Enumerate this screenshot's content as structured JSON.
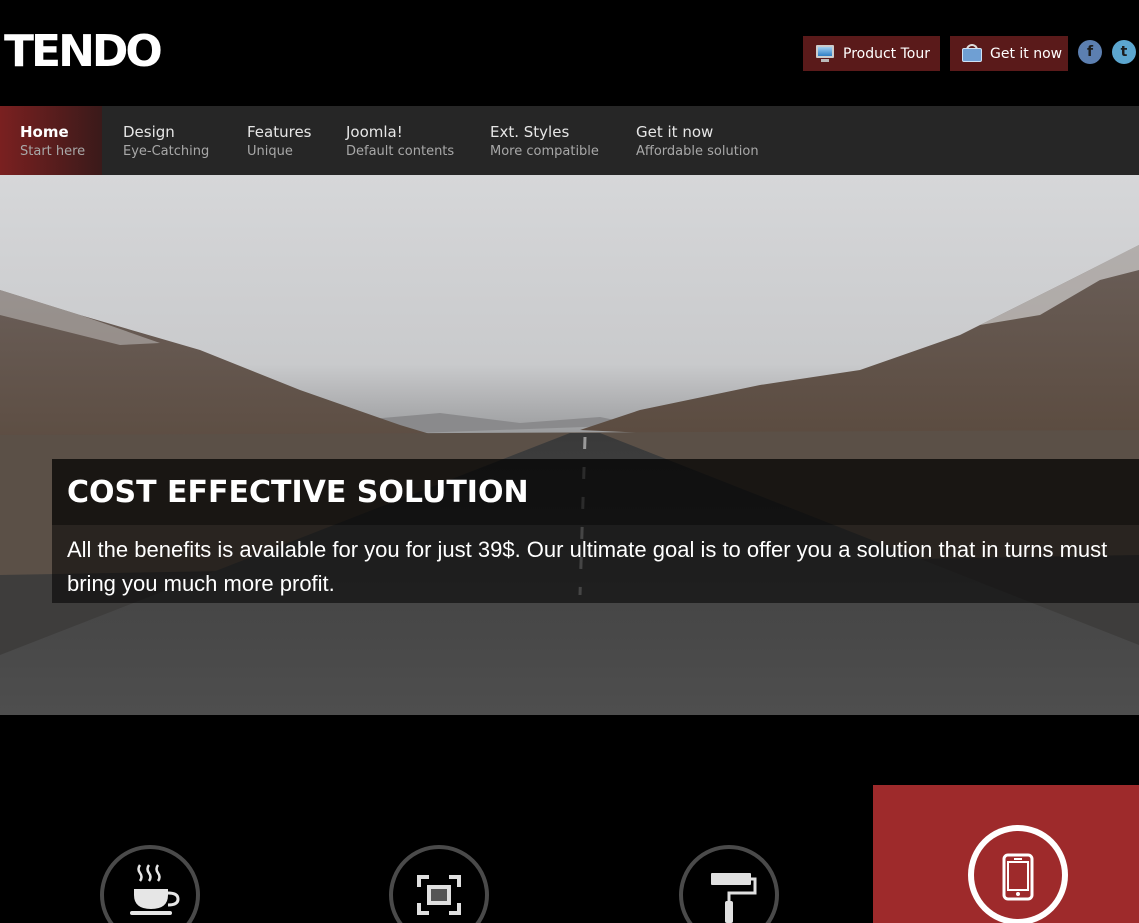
{
  "header": {
    "logo_text": "TENDO",
    "buttons": [
      {
        "label": "Product Tour",
        "icon": "monitor-icon"
      },
      {
        "label": "Get it now",
        "icon": "basket-icon"
      }
    ],
    "social": [
      {
        "icon": "facebook-icon",
        "glyph": "f"
      },
      {
        "icon": "twitter-icon",
        "glyph": "t"
      }
    ]
  },
  "nav": {
    "items": [
      {
        "title": "Home",
        "sub": "Start here",
        "active": true
      },
      {
        "title": "Design",
        "sub": "Eye-Catching"
      },
      {
        "title": "Features",
        "sub": "Unique"
      },
      {
        "title": "Joomla!",
        "sub": "Default contents"
      },
      {
        "title": "Ext. Styles",
        "sub": "More compatible"
      },
      {
        "title": "Get it now",
        "sub": "Affordable solution"
      }
    ]
  },
  "hero": {
    "title": "COST EFFECTIVE SOLUTION",
    "text": "All the benefits is available for you for just 39$. Our ultimate goal is to offer you a solution that in turns must bring you much more profit."
  },
  "features": {
    "icons": [
      "coffee-cup-icon",
      "frame-icon",
      "paint-roller-icon",
      "mobile-phone-icon"
    ]
  },
  "colors": {
    "accent": "#9e2a2b",
    "nav_bg": "#262626",
    "button_bg": "#5a1a1a"
  }
}
